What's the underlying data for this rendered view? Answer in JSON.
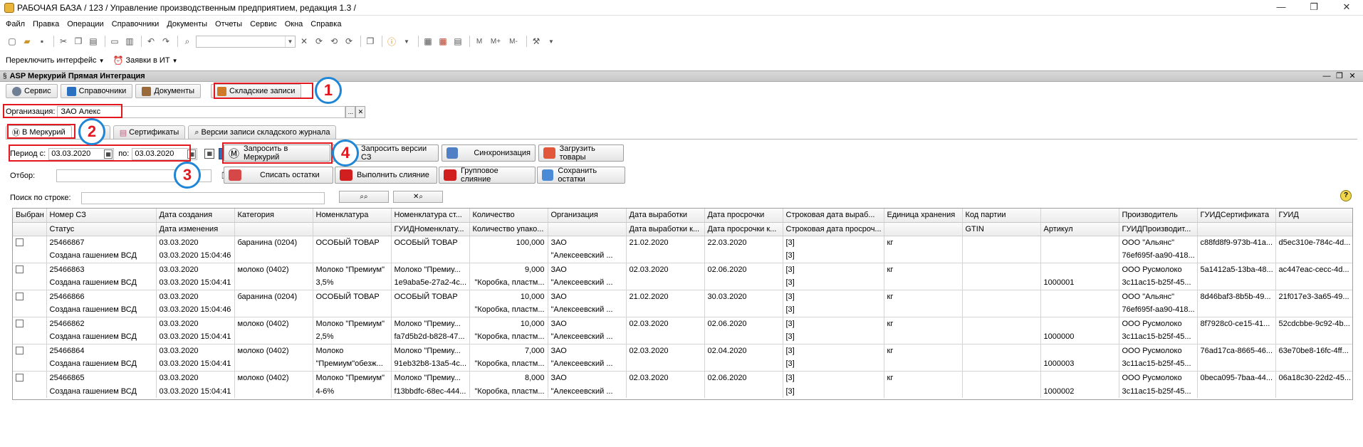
{
  "window": {
    "title": "РАБОЧАЯ БАЗА / 123 /  Управление производственным предприятием, редакция 1.3 /"
  },
  "menu": [
    "Файл",
    "Правка",
    "Операции",
    "Справочники",
    "Документы",
    "Отчеты",
    "Сервис",
    "Окна",
    "Справка"
  ],
  "toolbar2": {
    "switch_interface": "Переключить интерфейс",
    "it_requests": "Заявки в ИТ"
  },
  "panel": {
    "title": "ASP Меркурий Прямая Интеграция"
  },
  "top_tabs": [
    {
      "label": "Сервис",
      "color": "#6f7f96"
    },
    {
      "label": "Справочники",
      "color": "#2b6fc1"
    },
    {
      "label": "Документы",
      "color": "#9a6a3a"
    },
    {
      "label": "Складские записи",
      "color": "#d07a28"
    }
  ],
  "organization": {
    "label": "Организация:",
    "value": "ЗАО  Алекс"
  },
  "inner_tabs": [
    {
      "label": "В Меркурий",
      "icon": "mercury-icon"
    },
    {
      "label": "1С",
      "icon": ""
    },
    {
      "label": "Сертификаты",
      "icon": "certificate-icon"
    },
    {
      "label": "Версии записи складского журнала",
      "icon": "magnifier-icon"
    }
  ],
  "period": {
    "from_label": "Период с:",
    "from_value": "03.03.2020",
    "to_label": "по:",
    "to_value": "03.03.2020"
  },
  "buttons": {
    "request_mercury": "Запросить в Меркурий",
    "request_versions": "Запросить версии СЗ",
    "sync": "Синхронизация",
    "load_goods": "Загрузить товары",
    "write_off": "Списать остатки",
    "merge": "Выполнить слияние",
    "group_merge": "Групповое слияние",
    "save_rest": "Сохранить остатки"
  },
  "filter_label": "Отбор:",
  "search_label": "Поиск по строке:",
  "table": {
    "headers_top": [
      "Выбран",
      "Номер СЗ",
      "Дата создания",
      "Категория",
      "Номенклатура",
      "Номенклатура ст...",
      "Количество",
      "Организация",
      "Дата выработки",
      "Дата просрочки",
      "Строковая дата выраб...",
      "Единица хранения",
      "Код партии",
      "",
      "Производитель",
      "ГУИДСертификата",
      "ГУИД"
    ],
    "headers_bottom": [
      "",
      "Статус",
      "Дата изменения",
      "",
      "",
      "ГУИДНоменклату...",
      "Количество упако...",
      "",
      "Дата выработки к...",
      "Дата просрочки к...",
      "Строковая дата просроч...",
      "",
      "GTIN",
      "Артикул",
      "ГУИДПроизводит...",
      "",
      ""
    ],
    "rows": [
      {
        "num": "25466867",
        "status": "Создана гашением ВСД",
        "created": "03.03.2020",
        "changed": "03.03.2020 15:04:46",
        "category": "баранина (0204)",
        "nom1": "ОСОБЫЙ ТОВАР",
        "nom2": "",
        "nomst1": "ОСОБЫЙ ТОВАР",
        "nomst2": "",
        "qty": "100,000",
        "pack": "",
        "org1": "ЗАО",
        "org2": "\"Алексеевский ...",
        "prod": "21.02.2020",
        "exp": "22.03.2020",
        "str1": "[3]",
        "str2": "[3]",
        "unit": "кг",
        "article": "",
        "maker1": "ООО \"Альянс\"",
        "maker2": "76ef695f-aa90-418...",
        "cert": "c88fd8f9-973b-41a...",
        "guid": "d5ec310e-784c-4d..."
      },
      {
        "num": "25466863",
        "status": "Создана гашением ВСД",
        "created": "03.03.2020",
        "changed": "03.03.2020 15:04:41",
        "category": "молоко (0402)",
        "nom1": "Молоко \"Премиум\"",
        "nom2": "3,5%",
        "nomst1": "Молоко \"Премиу...",
        "nomst2": "1e9aba5e-27a2-4c...",
        "qty": "9,000",
        "pack": "\"Коробка, пластм...",
        "org1": "ЗАО",
        "org2": "\"Алексеевский ...",
        "prod": "02.03.2020",
        "exp": "02.06.2020",
        "str1": "[3]",
        "str2": "[3]",
        "unit": "кг",
        "article": "1000001",
        "maker1": "ООО Русмолоко",
        "maker2": "3c11ac15-b25f-45...",
        "cert": "5a1412a5-13ba-48...",
        "guid": "ac447eac-cecc-4d..."
      },
      {
        "num": "25466866",
        "status": "Создана гашением ВСД",
        "created": "03.03.2020",
        "changed": "03.03.2020 15:04:46",
        "category": "баранина (0204)",
        "nom1": "ОСОБЫЙ ТОВАР",
        "nom2": "",
        "nomst1": "ОСОБЫЙ ТОВАР",
        "nomst2": "",
        "qty": "10,000",
        "pack": "\"Коробка, пластм...",
        "org1": "ЗАО",
        "org2": "\"Алексеевский ...",
        "prod": "21.02.2020",
        "exp": "30.03.2020",
        "str1": "[3]",
        "str2": "[3]",
        "unit": "кг",
        "article": "",
        "maker1": "ООО \"Альянс\"",
        "maker2": "76ef695f-aa90-418...",
        "cert": "8d46baf3-8b5b-49...",
        "guid": "21f017e3-3a65-49..."
      },
      {
        "num": "25466862",
        "status": "Создана гашением ВСД",
        "created": "03.03.2020",
        "changed": "03.03.2020 15:04:41",
        "category": "молоко (0402)",
        "nom1": "Молоко \"Премиум\"",
        "nom2": "2,5%",
        "nomst1": "Молоко \"Премиу...",
        "nomst2": "fa7d5b2d-b828-47...",
        "qty": "10,000",
        "pack": "\"Коробка, пластм...",
        "org1": "ЗАО",
        "org2": "\"Алексеевский ...",
        "prod": "02.03.2020",
        "exp": "02.06.2020",
        "str1": "[3]",
        "str2": "[3]",
        "unit": "кг",
        "article": "1000000",
        "maker1": "ООО Русмолоко",
        "maker2": "3c11ac15-b25f-45...",
        "cert": "8f7928c0-ce15-41...",
        "guid": "52cdcbbe-9c92-4b..."
      },
      {
        "num": "25466864",
        "status": "Создана гашением ВСД",
        "created": "03.03.2020",
        "changed": "03.03.2020 15:04:41",
        "category": "молоко (0402)",
        "nom1": "Молоко",
        "nom2": "\"Премиум\"обезж...",
        "nomst1": "Молоко \"Премиу...",
        "nomst2": "91eb32b8-13a5-4c...",
        "qty": "7,000",
        "pack": "\"Коробка, пластм...",
        "org1": "ЗАО",
        "org2": "\"Алексеевский ...",
        "prod": "02.03.2020",
        "exp": "02.04.2020",
        "str1": "[3]",
        "str2": "[3]",
        "unit": "кг",
        "article": "1000003",
        "maker1": "ООО Русмолоко",
        "maker2": "3c11ac15-b25f-45...",
        "cert": "76ad17ca-8665-46...",
        "guid": "63e70be8-16fc-4ff..."
      },
      {
        "num": "25466865",
        "status": "Создана гашением ВСД",
        "created": "03.03.2020",
        "changed": "03.03.2020 15:04:41",
        "category": "молоко (0402)",
        "nom1": "Молоко \"Премиум\"",
        "nom2": "4-6%",
        "nomst1": "Молоко \"Премиу...",
        "nomst2": "f13bbdfc-68ec-444...",
        "qty": "8,000",
        "pack": "\"Коробка, пластм...",
        "org1": "ЗАО",
        "org2": "\"Алексеевский ...",
        "prod": "02.03.2020",
        "exp": "02.06.2020",
        "str1": "[3]",
        "str2": "[3]",
        "unit": "кг",
        "article": "1000002",
        "maker1": "ООО Русмолоко",
        "maker2": "3c11ac15-b25f-45...",
        "cert": "0beca095-7baa-44...",
        "guid": "06a18c30-22d2-45..."
      }
    ]
  },
  "annotations": [
    "1",
    "2",
    "3",
    "4"
  ],
  "colors": {
    "highlight": "#e2181e",
    "callout_ring": "#1f86d6"
  }
}
